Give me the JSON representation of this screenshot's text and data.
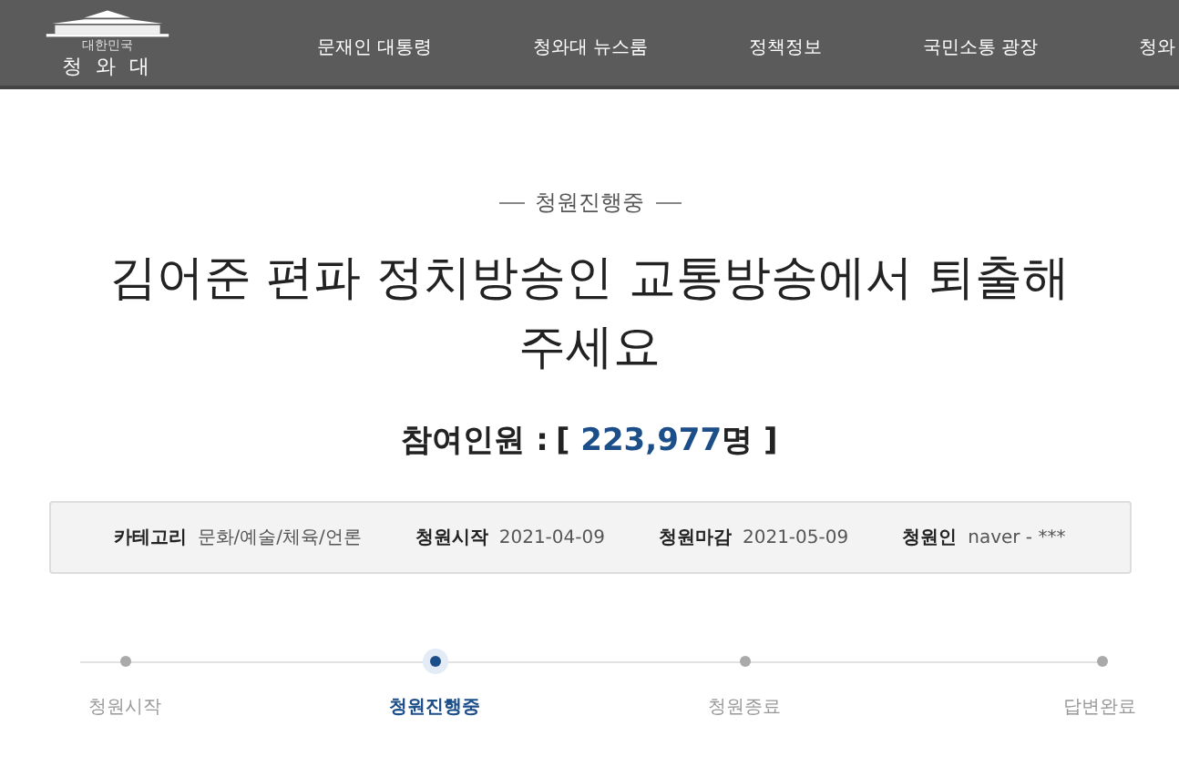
{
  "header": {
    "logo": {
      "small_caption": "대한민국",
      "caption": "청 와 대"
    },
    "nav": [
      {
        "label": "문재인 대통령"
      },
      {
        "label": "청와대 뉴스룸"
      },
      {
        "label": "정책정보"
      },
      {
        "label": "국민소통 광장"
      },
      {
        "label": "청와"
      }
    ]
  },
  "petition": {
    "status": "청원진행중",
    "title": "김어준 편파 정치방송인 교통방송에서 퇴출해 주세요",
    "count_label": "참여인원 :",
    "count_open": "[",
    "count": "223,977",
    "count_unit": "명",
    "count_close": "]",
    "info": [
      {
        "label": "카테고리",
        "value": "문화/예술/체육/언론"
      },
      {
        "label": "청원시작",
        "value": "2021-04-09"
      },
      {
        "label": "청원마감",
        "value": "2021-05-09"
      },
      {
        "label": "청원인",
        "value": "naver - ***"
      }
    ],
    "steps": [
      {
        "label": "청원시작",
        "selected": false
      },
      {
        "label": "청원진행중",
        "selected": true
      },
      {
        "label": "청원종료",
        "selected": false
      },
      {
        "label": "답변완료",
        "selected": false
      }
    ]
  }
}
